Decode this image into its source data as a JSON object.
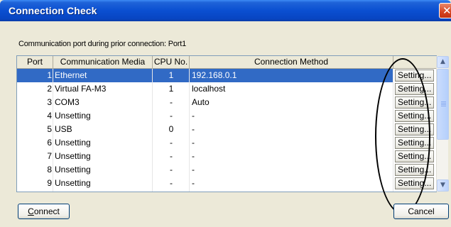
{
  "window": {
    "title": "Connection Check"
  },
  "info_text": "Communication port during prior connection: Port1",
  "table": {
    "headers": [
      "Port",
      "Communication Media",
      "CPU No.",
      "Connection Method",
      ""
    ],
    "button_label": "Setting...",
    "rows": [
      {
        "port": "1",
        "media": "Ethernet",
        "cpu": "1",
        "method": "192.168.0.1",
        "selected": true
      },
      {
        "port": "2",
        "media": "Virtual FA-M3",
        "cpu": "1",
        "method": "localhost",
        "selected": false
      },
      {
        "port": "3",
        "media": "COM3",
        "cpu": "-",
        "method": "Auto",
        "selected": false
      },
      {
        "port": "4",
        "media": "Unsetting",
        "cpu": "-",
        "method": "-",
        "selected": false
      },
      {
        "port": "5",
        "media": "USB",
        "cpu": "0",
        "method": "-",
        "selected": false
      },
      {
        "port": "6",
        "media": "Unsetting",
        "cpu": "-",
        "method": "-",
        "selected": false
      },
      {
        "port": "7",
        "media": "Unsetting",
        "cpu": "-",
        "method": "-",
        "selected": false
      },
      {
        "port": "8",
        "media": "Unsetting",
        "cpu": "-",
        "method": "-",
        "selected": false
      },
      {
        "port": "9",
        "media": "Unsetting",
        "cpu": "-",
        "method": "-",
        "selected": false
      }
    ]
  },
  "buttons": {
    "connect_mnemonic": "C",
    "connect_rest": "onnect",
    "cancel": "Cancel"
  },
  "colors": {
    "title_bar": "#0a4fd1",
    "selection": "#316ac5",
    "dialog_bg": "#ece9d8"
  },
  "icons": {
    "close": "close-icon",
    "scroll_up": "scroll-up-arrow-icon",
    "scroll_down": "scroll-down-arrow-icon"
  }
}
